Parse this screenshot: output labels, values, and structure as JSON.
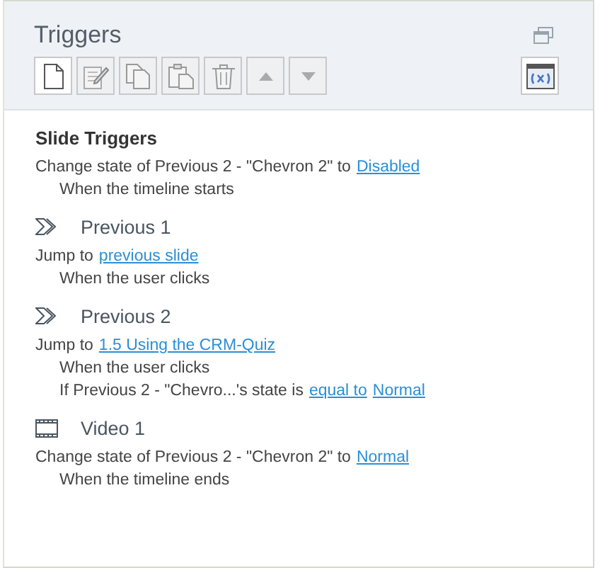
{
  "panel": {
    "title": "Triggers"
  },
  "toolbar": [
    {
      "kind": "new",
      "disabled": false
    },
    {
      "kind": "edit",
      "disabled": true
    },
    {
      "kind": "copy",
      "disabled": true
    },
    {
      "kind": "paste",
      "disabled": true
    },
    {
      "kind": "delete",
      "disabled": true
    },
    {
      "kind": "up",
      "disabled": true
    },
    {
      "kind": "down",
      "disabled": true
    }
  ],
  "groups": [
    {
      "kind": "slide",
      "title": "Slide Triggers",
      "lines": [
        {
          "kind": "action",
          "parts": [
            {
              "kind": "text",
              "text": "Change state of Previous 2 - \"Chevron 2\" to"
            },
            {
              "kind": "link",
              "text": "Disabled"
            }
          ]
        },
        {
          "kind": "condition",
          "parts": [
            {
              "kind": "text",
              "text": "When the timeline starts"
            }
          ]
        }
      ]
    },
    {
      "kind": "chevron",
      "title": "Previous 1",
      "lines": [
        {
          "kind": "action",
          "parts": [
            {
              "kind": "text",
              "text": "Jump to"
            },
            {
              "kind": "link",
              "text": "previous slide"
            }
          ]
        },
        {
          "kind": "condition",
          "parts": [
            {
              "kind": "text",
              "text": "When the user clicks"
            }
          ]
        }
      ]
    },
    {
      "kind": "chevron",
      "title": "Previous 2",
      "lines": [
        {
          "kind": "action",
          "parts": [
            {
              "kind": "text",
              "text": "Jump to"
            },
            {
              "kind": "link",
              "text": "1.5 Using the CRM-Quiz"
            }
          ]
        },
        {
          "kind": "condition",
          "parts": [
            {
              "kind": "text",
              "text": "When the user clicks"
            }
          ]
        },
        {
          "kind": "condition",
          "parts": [
            {
              "kind": "text",
              "text": "If Previous 2 - \"Chevro...'s state is"
            },
            {
              "kind": "link",
              "text": "equal to"
            },
            {
              "kind": "link",
              "text": "Normal"
            }
          ]
        }
      ]
    },
    {
      "kind": "video",
      "title": "Video 1",
      "lines": [
        {
          "kind": "action",
          "parts": [
            {
              "kind": "text",
              "text": "Change state of Previous 2 - \"Chevron 2\" to"
            },
            {
              "kind": "link",
              "text": "Normal"
            }
          ]
        },
        {
          "kind": "condition",
          "parts": [
            {
              "kind": "text",
              "text": "When the timeline ends"
            }
          ]
        }
      ]
    }
  ]
}
